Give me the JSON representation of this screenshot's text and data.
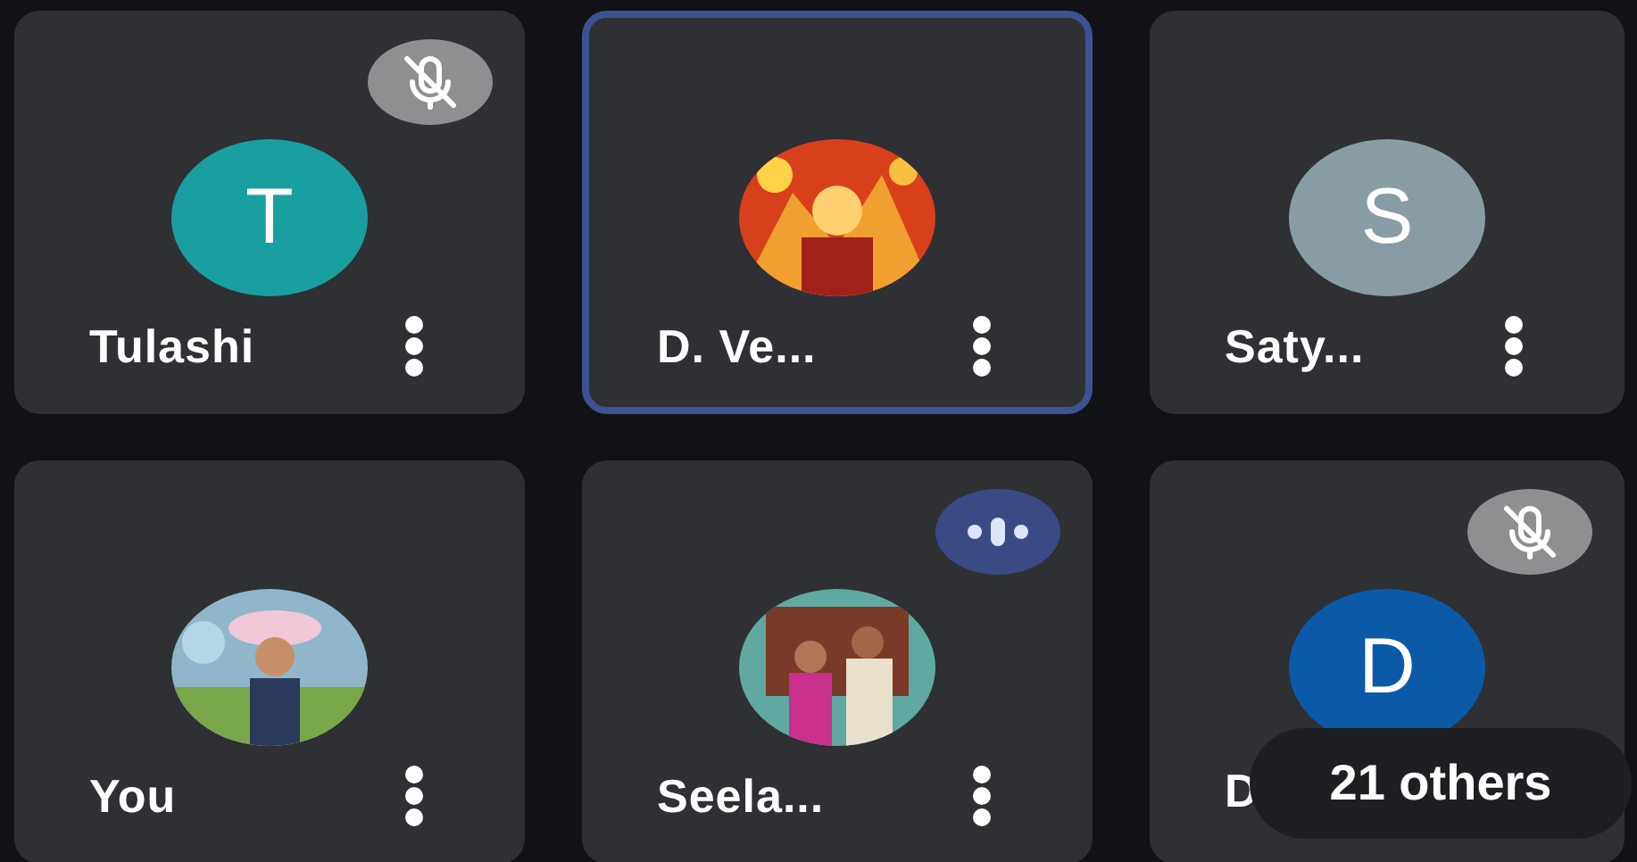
{
  "tiles": [
    {
      "name": "Tulashi",
      "avatar": {
        "kind": "letter",
        "letter": "T",
        "color": "#1a9fa1"
      },
      "selected": false,
      "muted": true,
      "speaking": false
    },
    {
      "name": "D. Ve...",
      "selected": true,
      "muted": false,
      "speaking": false
    },
    {
      "name": "Saty...",
      "avatar": {
        "kind": "letter",
        "letter": "S",
        "color": "#8a9ca3"
      },
      "selected": false,
      "muted": false,
      "speaking": false
    },
    {
      "name": "You",
      "selected": false,
      "muted": false,
      "speaking": false
    },
    {
      "name": "Seela...",
      "selected": false,
      "muted": false,
      "speaking": true
    },
    {
      "name": "D",
      "avatar": {
        "kind": "letter",
        "letter": "D",
        "color": "#0b5aa8"
      },
      "selected": false,
      "muted": true,
      "speaking": false
    }
  ],
  "overflow": {
    "label": "21 others"
  }
}
